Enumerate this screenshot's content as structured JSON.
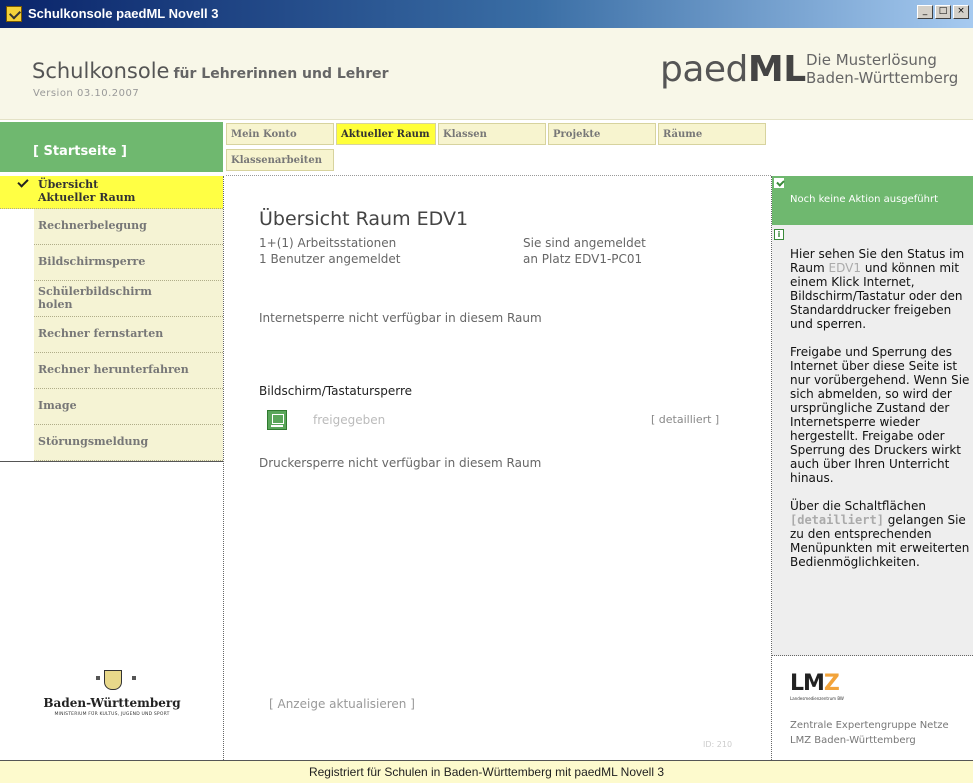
{
  "window": {
    "title": "Schulkonsole paedML Novell 3",
    "controls": [
      "_",
      "□",
      "×"
    ]
  },
  "header": {
    "app_name": "Schulkonsole",
    "app_sub": "für Lehrerinnen und Lehrer",
    "version": "Version 03.10.2007",
    "brand_light": "paed",
    "brand_bold": "ML",
    "brand_line1": "Die Musterlösung",
    "brand_line2": "Baden-Württemberg"
  },
  "startseite": "[ Startseite ]",
  "sidebar": {
    "items": [
      {
        "label1": "Übersicht",
        "label2": "Aktueller Raum"
      },
      {
        "label1": "Rechnerbelegung"
      },
      {
        "label1": "Bildschirmsperre"
      },
      {
        "label1": "Schülerbildschirm",
        "label2": "holen"
      },
      {
        "label1": "Rechner fernstarten"
      },
      {
        "label1": "Rechner herunterfahren"
      },
      {
        "label1": "Image"
      },
      {
        "label1": "Störungsmeldung"
      }
    ]
  },
  "tabs": [
    "Mein Konto",
    "Aktueller Raum",
    "Klassen",
    "Projekte",
    "Räume",
    "Klassenarbeiten"
  ],
  "main": {
    "title": "Übersicht Raum EDV1",
    "stat_left1": "1+(1) Arbeitsstationen",
    "stat_left2": "1 Benutzer angemeldet",
    "stat_right1": "Sie sind angemeldet",
    "stat_right2": "an Platz EDV1-PC01",
    "internet": "Internetsperre nicht verfügbar in diesem Raum",
    "screen_section": "Bildschirm/Tastatursperre",
    "screen_state": "freigegeben",
    "detail": "[ detailliert ]",
    "printer": "Druckersperre nicht verfügbar in diesem Raum",
    "refresh": "[ Anzeige aktualisieren ]",
    "page_id": "ID: 210"
  },
  "right_panel": {
    "status": "Noch keine Aktion ausgeführt",
    "info_icon": "i",
    "p1_a": "Hier sehen Sie den Status im Raum ",
    "p1_room": "EDV1",
    "p1_b": " und können mit einem Klick Internet, Bildschirm/Tastatur oder den Standarddrucker freigeben und sperren.",
    "p2": "Freigabe und Sperrung des Internet über diese Seite ist nur vorübergehend. Wenn Sie sich abmelden, so wird der ursprüngliche Zustand der Internetsperre wieder hergestellt. Freigabe oder Sperrung des Druckers wirkt auch über Ihren Unterricht hinaus.",
    "p3_a": "Über die Schaltflächen ",
    "p3_btn": "[detailliert]",
    "p3_b": " gelangen Sie zu den entsprechenden Menüpunkten mit erweiterten Bedienmöglichkeiten.",
    "lmz_logo_a": "LM",
    "lmz_logo_z": "Z",
    "lmz_logo_small": "Landesmedienzentrum BW",
    "footer1": "Zentrale Expertengruppe Netze",
    "footer2": "LMZ Baden-Württemberg"
  },
  "footer_logo": {
    "name": "Baden-Württemberg",
    "ministry": "MINISTERIUM FÜR KULTUS, JUGEND UND SPORT"
  },
  "statusbar": "Registriert für Schulen in Baden-Württemberg mit paedML Novell 3"
}
